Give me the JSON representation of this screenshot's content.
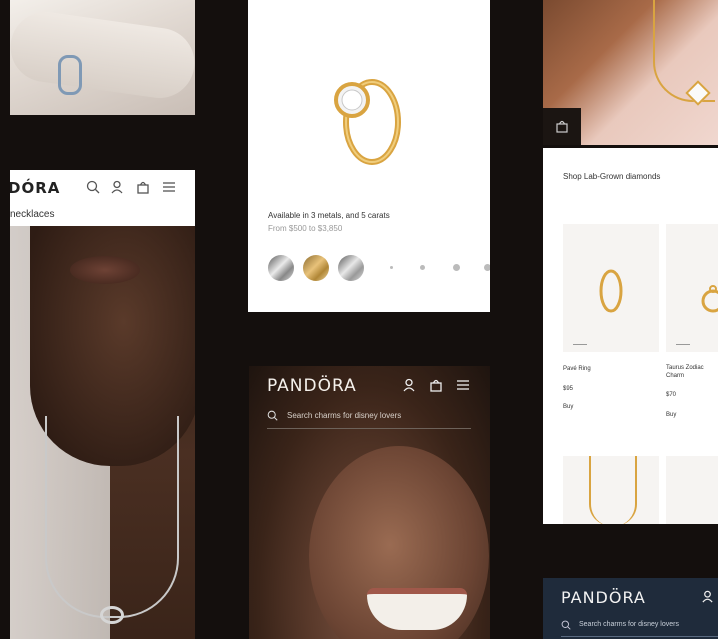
{
  "left_phone": {
    "brand": "DÓRA",
    "category": "necklaces",
    "header_icons": [
      "search-icon",
      "user-icon",
      "bag-icon",
      "menu-icon"
    ]
  },
  "product_card": {
    "description": "Available in 3 metals, and 5 carats",
    "price_range": "From $500 to $3,850",
    "metal_swatches": [
      "silver",
      "gold",
      "rose"
    ]
  },
  "dark_phone": {
    "brand": "PANDÖRA",
    "search_placeholder": "Search charms for disney lovers",
    "header_icons": [
      "user-icon",
      "bag-icon",
      "menu-icon"
    ]
  },
  "right_phone": {
    "section_title": "Shop Lab-Grown diamonds",
    "products": [
      {
        "name": "Pavé Ring",
        "price": "$95",
        "action": "Buy"
      },
      {
        "name": "Taurus Zodiac Charm",
        "price": "$70",
        "action": "Buy"
      }
    ]
  },
  "bottom_phone": {
    "brand": "PANDÖRA",
    "search_placeholder": "Search charms for disney lovers"
  },
  "colors": {
    "background": "#140f0d",
    "navy_header": "#1f2b3b",
    "gold": "#d9a441"
  }
}
